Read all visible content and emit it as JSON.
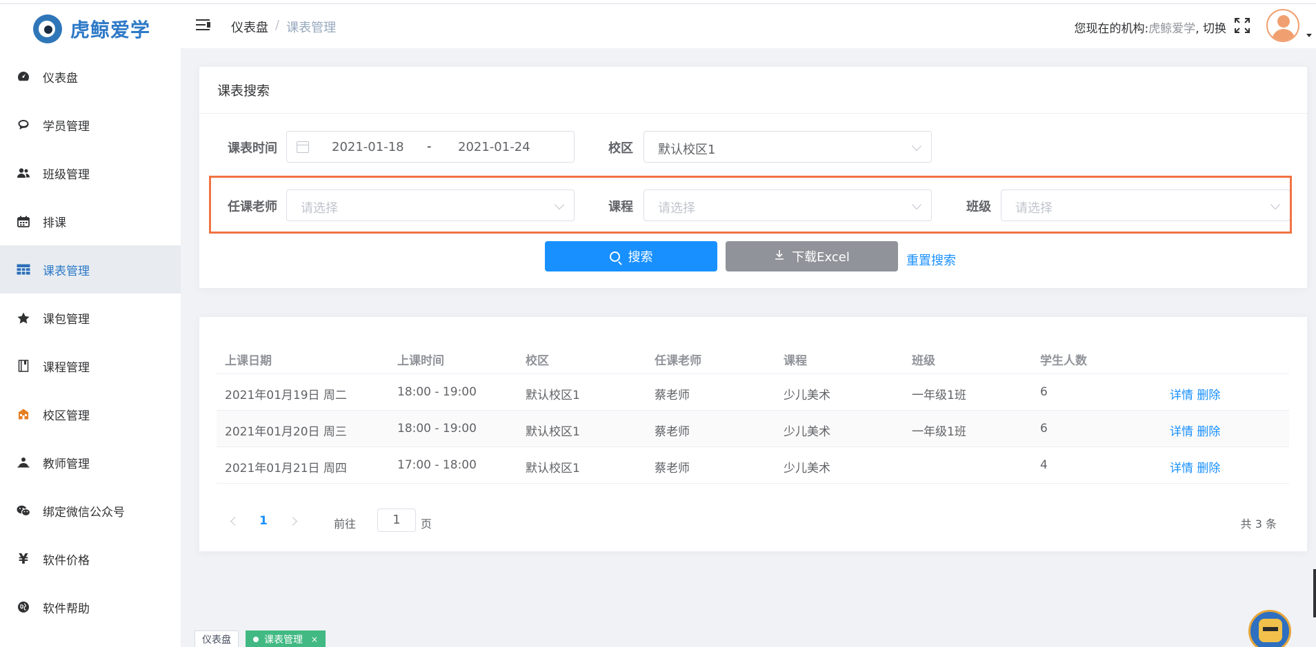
{
  "app": {
    "name": "虎鲸爱学"
  },
  "sidebar": {
    "items": [
      {
        "label": "仪表盘",
        "icon": "dashboard-icon"
      },
      {
        "label": "学员管理",
        "icon": "student-icon"
      },
      {
        "label": "班级管理",
        "icon": "class-icon"
      },
      {
        "label": "排课",
        "icon": "calendar-icon"
      },
      {
        "label": "课表管理",
        "icon": "timetable-icon"
      },
      {
        "label": "课包管理",
        "icon": "star-icon"
      },
      {
        "label": "课程管理",
        "icon": "book-icon"
      },
      {
        "label": "校区管理",
        "icon": "school-icon"
      },
      {
        "label": "教师管理",
        "icon": "teacher-icon"
      },
      {
        "label": "绑定微信公众号",
        "icon": "wechat-icon"
      },
      {
        "label": "软件价格",
        "icon": "yuan-icon"
      },
      {
        "label": "软件帮助",
        "icon": "help-icon"
      }
    ],
    "active_index": 4
  },
  "header": {
    "breadcrumb_home": "仪表盘",
    "breadcrumb_sep": "/",
    "breadcrumb_current": "课表管理",
    "org_prefix": "您现在的机构: ",
    "org_name": "虎鲸爱学",
    "org_switch": " , 切换"
  },
  "search": {
    "title": "课表搜索",
    "date_label": "课表时间",
    "date_start": "2021-01-18",
    "date_sep": "-",
    "date_end": "2021-01-24",
    "campus_label": "校区",
    "campus_value": "默认校区1",
    "teacher_label": "任课老师",
    "teacher_placeholder": "请选择",
    "course_label": "课程",
    "course_placeholder": "请选择",
    "class_label": "班级",
    "class_placeholder": "请选择",
    "search_btn": "搜索",
    "download_btn": "下载Excel",
    "reset_link": "重置搜索"
  },
  "table": {
    "headers": [
      "上课日期",
      "上课时间",
      "校区",
      "任课老师",
      "课程",
      "班级",
      "学生人数"
    ],
    "rows": [
      [
        "2021年01月19日 周二",
        "18:00 - 19:00",
        "默认校区1",
        "蔡老师",
        "少儿美术",
        "一年级1班",
        "6"
      ],
      [
        "2021年01月20日 周三",
        "18:00 - 19:00",
        "默认校区1",
        "蔡老师",
        "少儿美术",
        "一年级1班",
        "6"
      ],
      [
        "2021年01月21日 周四",
        "17:00 - 18:00",
        "默认校区1",
        "蔡老师",
        "少儿美术",
        "",
        "4"
      ]
    ],
    "action_detail": "详情",
    "action_delete": "删除"
  },
  "pager": {
    "current": "1",
    "goto_prefix": "前往",
    "goto_value": "1",
    "goto_suffix": "页",
    "total": "共 3 条"
  },
  "tags": {
    "tag1": "仪表盘",
    "tag2": "课表管理",
    "close": "×"
  },
  "colors": {
    "primary": "#1890ff",
    "highlight": "#f07343",
    "active_tag": "#42b983"
  }
}
